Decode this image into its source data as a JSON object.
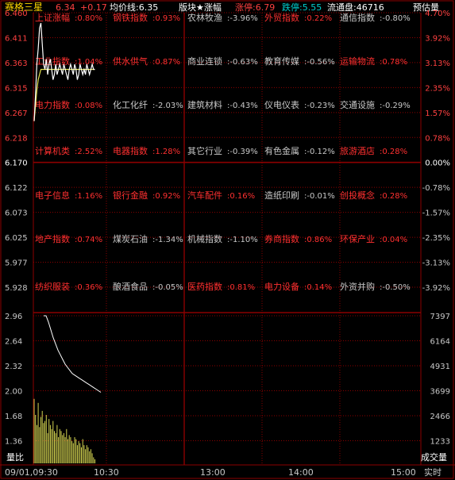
{
  "header": {
    "stock_name": "赛格三星",
    "price": "6.34",
    "change": "+0.17",
    "avg_label": "均价线:6.35",
    "sector_label": "版块★涨幅",
    "limit_up": "涨停:6.79",
    "limit_down": "跌停:5.55",
    "float_cap": "流通盘:46716",
    "forecast_vol": "预估量"
  },
  "price_axis": {
    "left_ticks": [
      "6.460",
      "6.411",
      "6.363",
      "6.315",
      "6.267",
      "6.218",
      "6.170",
      "6.122",
      "6.073",
      "6.025",
      "5.977",
      "5.928"
    ],
    "right_ticks": [
      "4.70%",
      "3.92%",
      "3.13%",
      "2.35%",
      "1.57%",
      "0.78%",
      "0.00%",
      "-0.78%",
      "-1.57%",
      "-2.35%",
      "-3.13%",
      "-3.92%"
    ]
  },
  "volume_axis": {
    "left_ticks": [
      "2.96",
      "2.64",
      "2.32",
      "2.00",
      "1.68",
      "1.36"
    ],
    "right_ticks": [
      "7397",
      "6164",
      "4931",
      "3699",
      "2466",
      "1233"
    ],
    "left_title": "量比",
    "right_title": "成交量"
  },
  "time_axis": {
    "labels": [
      "09/01,09:30",
      "10:30",
      "13:00",
      "14:00",
      "15:00"
    ],
    "right_label": "实时"
  },
  "sectors": [
    {
      "name": "上证涨幅",
      "value": "0.80%",
      "highlight": true
    },
    {
      "name": "钢铁指数",
      "value": "0.93%",
      "highlight": true
    },
    {
      "name": "农林牧渔",
      "value": "-3.96%",
      "highlight": false
    },
    {
      "name": "外贸指数",
      "value": "0.22%",
      "highlight": true
    },
    {
      "name": "通信指数",
      "value": "-0.80%",
      "highlight": false
    },
    {
      "name": "工业指数",
      "value": "1.04%",
      "highlight": true
    },
    {
      "name": "供水供气",
      "value": "0.87%",
      "highlight": true
    },
    {
      "name": "商业连锁",
      "value": "-0.63%",
      "highlight": false
    },
    {
      "name": "教育传媒",
      "value": "-0.56%",
      "highlight": false
    },
    {
      "name": "运输物流",
      "value": "0.78%",
      "highlight": true
    },
    {
      "name": "电力指数",
      "value": "0.08%",
      "highlight": true
    },
    {
      "name": "化工化纤",
      "value": "-2.03%",
      "highlight": false
    },
    {
      "name": "建筑材料",
      "value": "-0.43%",
      "highlight": false
    },
    {
      "name": "仪电仪表",
      "value": "-0.23%",
      "highlight": false
    },
    {
      "name": "交通设施",
      "value": "-0.29%",
      "highlight": false
    },
    {
      "name": "计算机类",
      "value": "2.52%",
      "highlight": true
    },
    {
      "name": "电器指数",
      "value": "1.28%",
      "highlight": true
    },
    {
      "name": "其它行业",
      "value": "-0.39%",
      "highlight": false
    },
    {
      "name": "有色金属",
      "value": "-0.12%",
      "highlight": false
    },
    {
      "name": "旅游酒店",
      "value": "0.28%",
      "highlight": true
    },
    {
      "name": "电子信息",
      "value": "1.16%",
      "highlight": true
    },
    {
      "name": "银行金融",
      "value": "0.92%",
      "highlight": true
    },
    {
      "name": "汽车配件",
      "value": "0.16%",
      "highlight": true
    },
    {
      "name": "造纸印刷",
      "value": "-0.01%",
      "highlight": false
    },
    {
      "name": "创投概念",
      "value": "0.28%",
      "highlight": true
    },
    {
      "name": "地产指数",
      "value": "0.74%",
      "highlight": true
    },
    {
      "name": "煤炭石油",
      "value": "-1.34%",
      "highlight": false
    },
    {
      "name": "机械指数",
      "value": "-1.10%",
      "highlight": false
    },
    {
      "name": "券商指数",
      "value": "0.86%",
      "highlight": true
    },
    {
      "name": "环保产业",
      "value": "0.04%",
      "highlight": true
    },
    {
      "name": "纺织服装",
      "value": "0.36%",
      "highlight": true
    },
    {
      "name": "酿酒食品",
      "value": "-0.05%",
      "highlight": false
    },
    {
      "name": "医药指数",
      "value": "0.81%",
      "highlight": true
    },
    {
      "name": "电力设备",
      "value": "0.14%",
      "highlight": true
    },
    {
      "name": "外资并购",
      "value": "-0.50%",
      "highlight": false
    }
  ],
  "colors": {
    "background": "#000000",
    "grid": "#8b0000",
    "up": "#ff3030",
    "down": "#c8c8c8",
    "price_line": "#ffffff",
    "avg_line": "#e6e650",
    "volume_bar": "#d2d250",
    "header_name": "#ffd700",
    "header_value": "#ff4040",
    "header_label": "#ffffff"
  },
  "chart_data": {
    "type": "line",
    "title": "赛格三星",
    "series": [
      {
        "name": "price",
        "x": [
          "09:30",
          "09:31",
          "09:32",
          "09:33",
          "09:34",
          "09:35",
          "09:36",
          "09:37",
          "09:38",
          "09:39",
          "09:40",
          "09:41",
          "09:42",
          "09:43",
          "09:44",
          "09:45",
          "09:46",
          "09:47",
          "09:48",
          "09:49",
          "09:50",
          "09:51",
          "09:52",
          "09:53",
          "09:54",
          "09:55",
          "09:56",
          "09:57",
          "09:58",
          "09:59",
          "10:00",
          "10:01",
          "10:02",
          "10:03",
          "10:04",
          "10:05",
          "10:06",
          "10:07",
          "10:08",
          "10:09",
          "10:10",
          "10:11",
          "10:12",
          "10:13",
          "10:14",
          "10:15"
        ],
        "values": [
          6.25,
          6.3,
          6.36,
          6.39,
          6.43,
          6.44,
          6.4,
          6.36,
          6.35,
          6.37,
          6.34,
          6.36,
          6.37,
          6.35,
          6.33,
          6.34,
          6.36,
          6.34,
          6.35,
          6.36,
          6.35,
          6.34,
          6.36,
          6.35,
          6.34,
          6.33,
          6.35,
          6.36,
          6.35,
          6.34,
          6.36,
          6.35,
          6.33,
          6.34,
          6.36,
          6.35,
          6.34,
          6.35,
          6.34,
          6.36,
          6.35,
          6.34,
          6.35,
          6.36,
          6.35,
          6.35
        ]
      },
      {
        "name": "avg",
        "values": [
          6.25,
          6.28,
          6.31,
          6.33,
          6.34,
          6.35,
          6.35,
          6.35,
          6.35,
          6.35,
          6.35,
          6.35,
          6.35,
          6.35,
          6.35,
          6.35,
          6.35,
          6.35,
          6.35,
          6.35,
          6.35,
          6.35,
          6.35,
          6.35,
          6.35,
          6.35,
          6.35,
          6.35,
          6.35,
          6.35,
          6.35,
          6.35,
          6.35,
          6.35,
          6.35,
          6.35,
          6.35,
          6.35,
          6.35,
          6.35,
          6.35,
          6.35,
          6.35,
          6.35,
          6.35,
          6.35
        ]
      },
      {
        "name": "volume_ratio",
        "values": [
          2.96,
          2.96,
          2.88,
          2.78,
          2.68,
          2.6,
          2.52,
          2.46,
          2.4,
          2.34,
          2.3,
          2.26,
          2.22,
          2.2,
          2.18,
          2.16,
          2.14,
          2.12,
          2.1,
          2.08,
          2.06,
          2.04,
          2.02,
          2.0,
          1.98
        ]
      },
      {
        "name": "volume",
        "values": [
          3200,
          2400,
          1900,
          3000,
          1800,
          2300,
          2600,
          2000,
          2100,
          2400,
          1500,
          2200,
          1900,
          1700,
          2100,
          1600,
          1500,
          1900,
          1300,
          1700,
          1600,
          1400,
          1500,
          1300,
          1700,
          1200,
          1400,
          1300,
          1100,
          1000,
          1300,
          1200,
          900,
          1100,
          1000,
          800,
          1200,
          900,
          700,
          900,
          800,
          600,
          700,
          500,
          300,
          200
        ]
      }
    ],
    "ylim": [
      5.928,
      6.46
    ],
    "prev_close": 6.17
  }
}
